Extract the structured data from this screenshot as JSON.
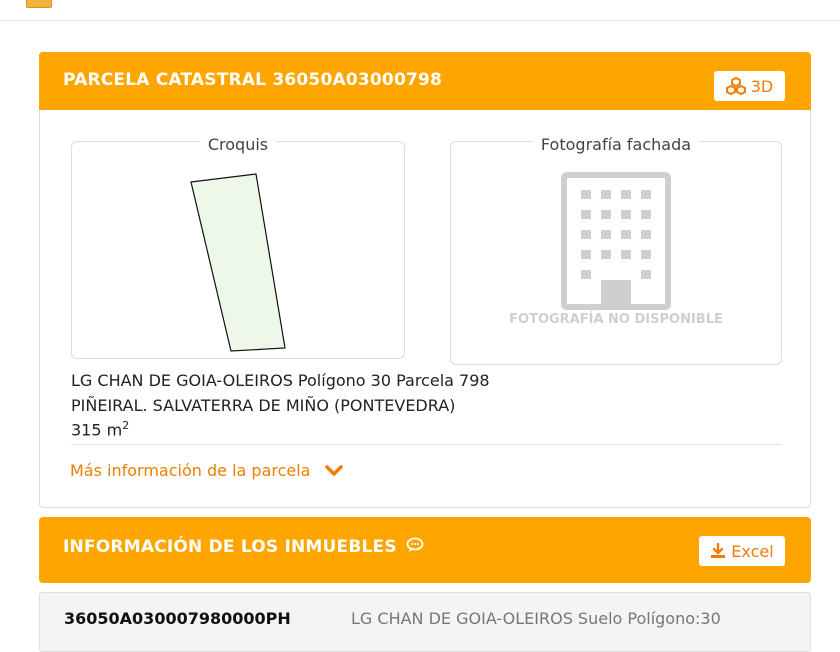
{
  "parcel": {
    "title": "PARCELA CATASTRAL 36050A03000798",
    "btn_3d_label": "3D",
    "sketch_label": "Croquis",
    "photo_label": "Fotografía fachada",
    "photo_unavailable": "FOTOGRAFÍA NO DISPONIBLE",
    "address_line1": "LG CHAN DE GOIA-OLEIROS Polígono 30 Parcela 798",
    "address_line2": "PIÑEIRAL. SALVATERRA DE MIÑO (PONTEVEDRA)",
    "area_value": "315 m",
    "area_sup": "2",
    "more_info": "Más información de la parcela"
  },
  "properties": {
    "title": "INFORMACIÓN DE LOS INMUEBLES",
    "excel_label": "Excel",
    "rows": [
      {
        "ref": "36050A030007980000PH",
        "desc": "LG CHAN DE GOIA-OLEIROS Suelo Polígono:30"
      }
    ]
  },
  "colors": {
    "accent": "#ffa500",
    "link": "#f07d00",
    "parcel_fill": "#edf7ea"
  },
  "icons": [
    "3d-cubes-icon",
    "building-placeholder-icon",
    "chevron-down-icon",
    "chat-icon",
    "download-icon"
  ]
}
